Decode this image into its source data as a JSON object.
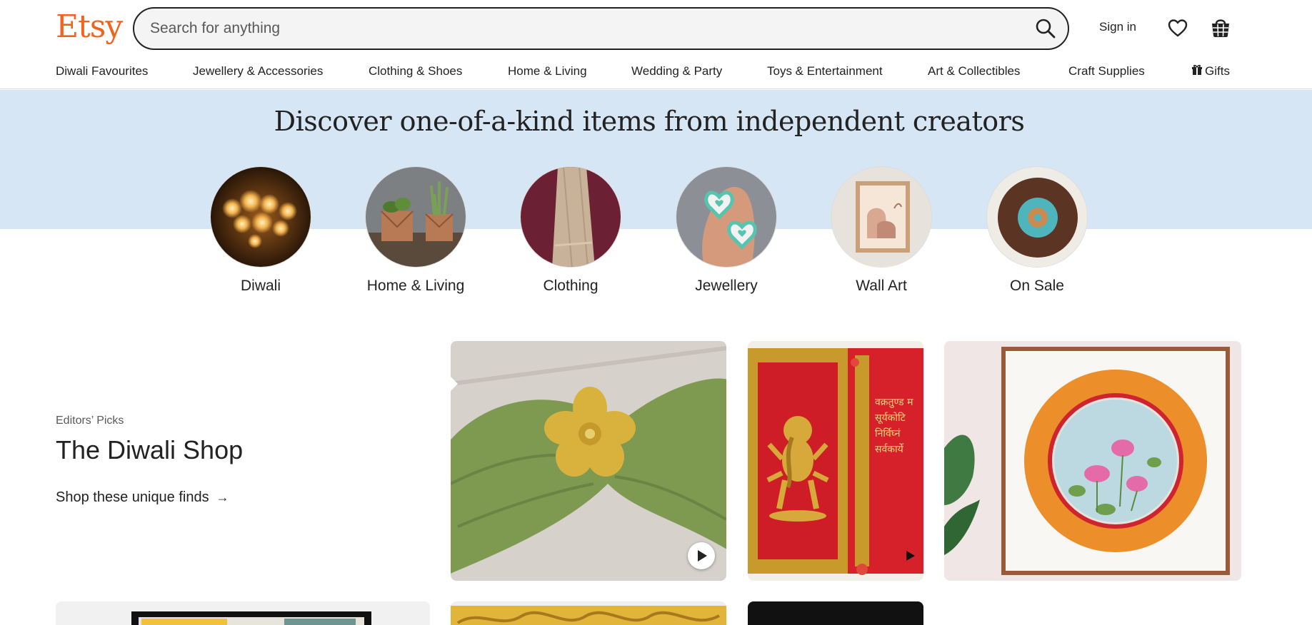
{
  "header": {
    "logo": "Etsy",
    "search_placeholder": "Search for anything",
    "signin_label": "Sign in"
  },
  "nav": {
    "categories": [
      "Diwali Favourites",
      "Jewellery & Accessories",
      "Clothing & Shoes",
      "Home & Living",
      "Wedding & Party",
      "Toys & Entertainment",
      "Art & Collectibles",
      "Craft Supplies",
      "Gifts"
    ]
  },
  "hero": {
    "title": "Discover one-of-a-kind items from independent creators",
    "circles": [
      "Diwali",
      "Home & Living",
      "Clothing",
      "Jewellery",
      "Wall Art",
      "On Sale"
    ]
  },
  "editors": {
    "eyebrow": "Editors’ Picks",
    "title": "The Diwali Shop",
    "link_label": "Shop these unique finds",
    "arrow": "→"
  },
  "colors": {
    "brand": "#F1641E",
    "hero_band": "#d7e6f5"
  },
  "icons": {
    "search": "search-icon",
    "favorites": "heart-icon",
    "cart": "basket-icon",
    "gift": "gift-icon",
    "play": "play-icon"
  }
}
